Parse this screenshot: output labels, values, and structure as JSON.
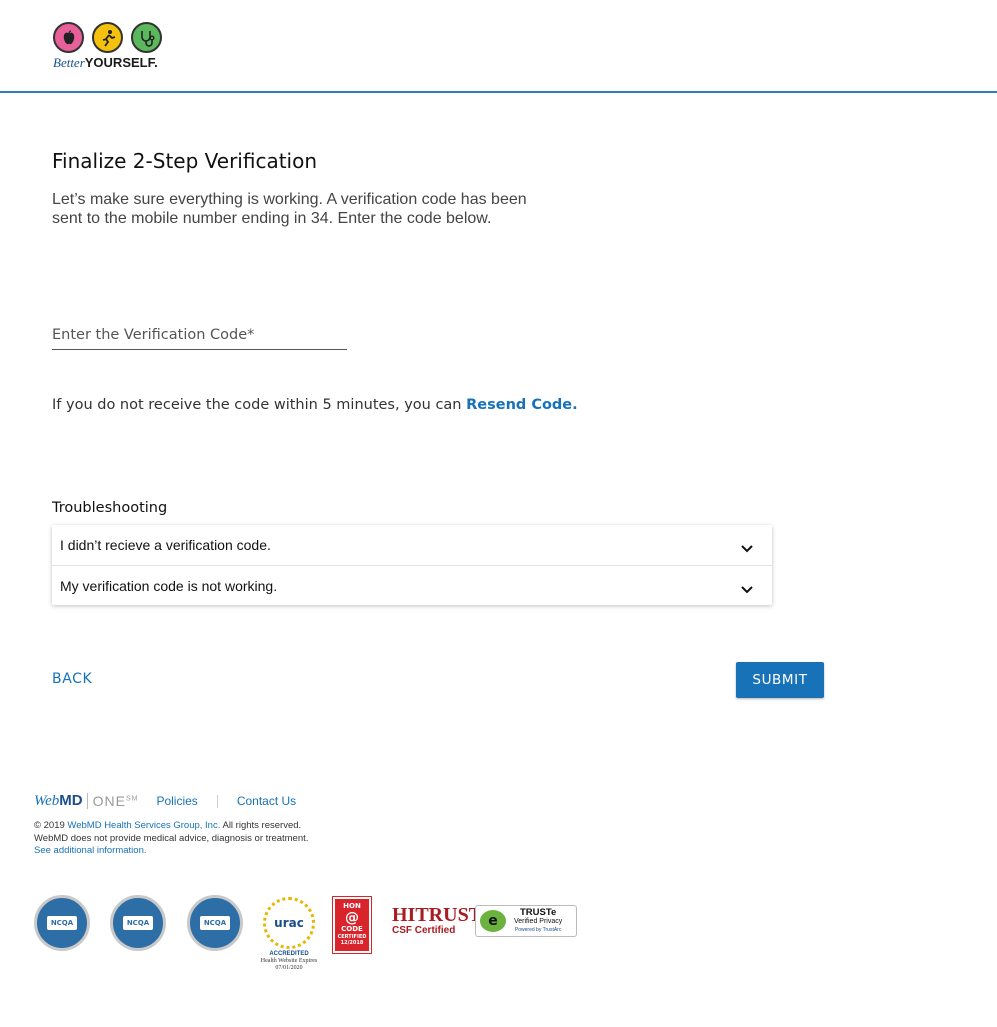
{
  "brand": {
    "logo_better": "Better",
    "logo_yourself": "YOURSELF."
  },
  "main": {
    "title": "Finalize 2-Step Verification",
    "description": "Let’s make sure everything is working. A verification code has been sent to the mobile number ending in 34. Enter the code below.",
    "code_field_placeholder": "Enter the Verification Code*",
    "resend_text": "If you do not receive the code within 5 minutes, you can",
    "resend_link": "Resend Code.",
    "troubleshooting_label": "Troubleshooting",
    "troubleshooting_items": [
      "I didn’t recieve a verification code.",
      "My verification code is not working."
    ],
    "back_label": "BACK",
    "submit_label": "SUBMIT"
  },
  "footer": {
    "webmd_web": "Web",
    "webmd_md": "MD",
    "one": "ONE",
    "one_sup": "SM",
    "policies": "Policies",
    "contact": "Contact Us",
    "copyright_prefix": "© 2019",
    "copyright_link": "WebMD Health Services Group, Inc.",
    "copyright_suffix": "All rights reserved.",
    "disclaimer": "WebMD does not provide medical advice, diagnosis or treatment.",
    "additional": "See additional information.",
    "badges": {
      "ncqa": "NCQA",
      "urac": "urac",
      "urac_accredited": "ACCREDITED",
      "urac_sub": "Health Website Expires 07/01/2020",
      "hon_line1": "HON",
      "hon_line2": "CODE",
      "hon_line3": "CERTIFIED 12/2018",
      "hitrust": "HITRUST",
      "hitrust_sub": "CSF Certified",
      "truste_title": "TRUSTe",
      "truste_line2": "Verified Privacy",
      "truste_line3": "Powered by TrustArc"
    }
  },
  "colors": {
    "accent": "#1772b8",
    "header_rule": "#2a7fc1"
  }
}
